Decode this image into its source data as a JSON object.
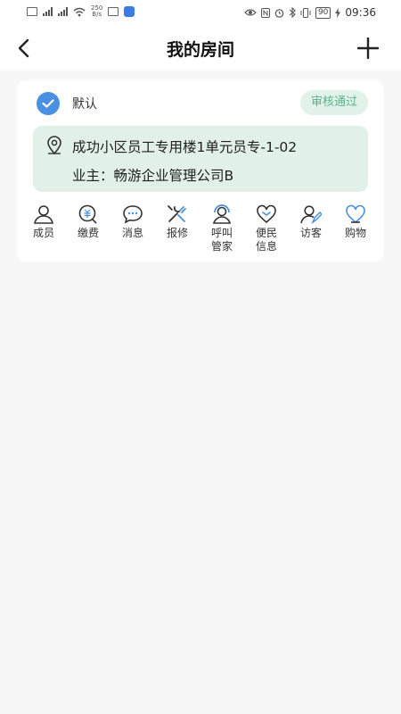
{
  "status_bar": {
    "net_speed_value": "250",
    "net_speed_unit": "B/s",
    "battery": "90",
    "time": "09:36"
  },
  "header": {
    "title": "我的房间"
  },
  "room_card": {
    "default_label": "默认",
    "status": "审核通过",
    "address": "成功小区员工专用楼1单元员专-1-02",
    "owner": "业主：畅游企业管理公司B"
  },
  "actions": [
    {
      "label": "成员",
      "icon": "person-icon"
    },
    {
      "label": "缴费",
      "icon": "payment-icon"
    },
    {
      "label": "消息",
      "icon": "message-icon"
    },
    {
      "label": "报修",
      "icon": "repair-icon"
    },
    {
      "label": "呼叫管家",
      "icon": "call-housekeeper-icon"
    },
    {
      "label": "便民信息",
      "icon": "heart-icon"
    },
    {
      "label": "访客",
      "icon": "visitor-icon"
    },
    {
      "label": "购物",
      "icon": "shopping-icon"
    }
  ],
  "colors": {
    "accent_blue": "#4a90e2",
    "badge_bg": "#e2f2ea",
    "badge_text": "#58b58a",
    "address_bg": "#e1f0e8"
  }
}
